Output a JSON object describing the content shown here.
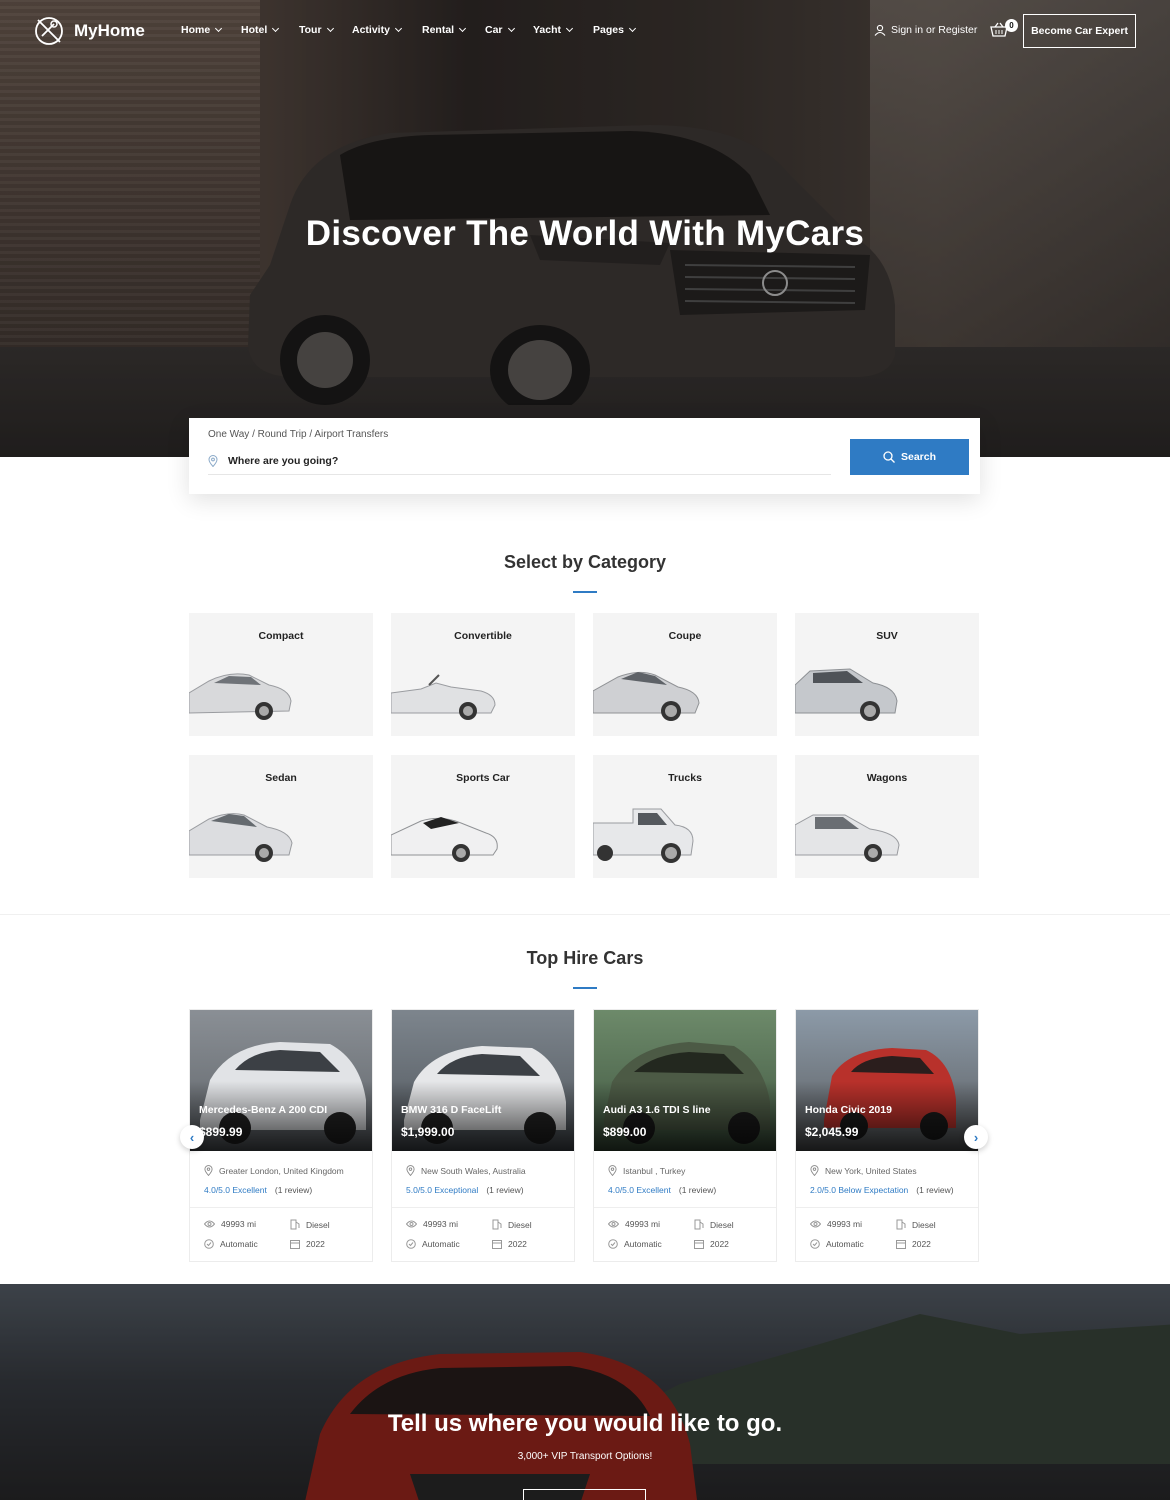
{
  "brand": {
    "name": "MyHome"
  },
  "nav": {
    "items": [
      "Home",
      "Hotel",
      "Tour",
      "Activity",
      "Rental",
      "Car",
      "Yacht",
      "Pages"
    ],
    "signin": "Sign in or Register",
    "cart_count": "0",
    "cta": "Become Car Expert"
  },
  "hero": {
    "title": "Discover The World With MyCars"
  },
  "search": {
    "trip_types": "One Way / Round Trip / Airport Transfers",
    "placeholder": "Where are you going?",
    "button": "Search"
  },
  "categories": {
    "title": "Select by Category",
    "items": [
      "Compact",
      "Convertible",
      "Coupe",
      "SUV",
      "Sedan",
      "Sports Car",
      "Trucks",
      "Wagons"
    ]
  },
  "top_cars": {
    "title": "Top Hire Cars",
    "cards": [
      {
        "name": "Mercedes-Benz A 200 CDI",
        "price": "$899.99",
        "location": "Greater London, United Kingdom",
        "score": "4.0/5.0 Excellent",
        "reviews": "(1 review)",
        "mileage": "49993 mi",
        "fuel": "Diesel",
        "transmission": "Automatic",
        "year": "2022",
        "color": "#c9ccd0"
      },
      {
        "name": "BMW 316 D FaceLift",
        "price": "$1,999.00",
        "location": "New South Wales, Australia",
        "score": "5.0/5.0 Exceptional",
        "reviews": "(1 review)",
        "mileage": "49993 mi",
        "fuel": "Diesel",
        "transmission": "Automatic",
        "year": "2022",
        "color": "#d6d8da"
      },
      {
        "name": "Audi A3 1.6 TDI S line",
        "price": "$899.00",
        "location": "Istanbul , Turkey",
        "score": "4.0/5.0 Excellent",
        "reviews": "(1 review)",
        "mileage": "49993 mi",
        "fuel": "Diesel",
        "transmission": "Automatic",
        "year": "2022",
        "color": "#4c5a45"
      },
      {
        "name": "Honda Civic 2019",
        "price": "$2,045.99",
        "location": "New York, United States",
        "score": "2.0/5.0 Below Expectation",
        "reviews": "(1 review)",
        "mileage": "49993 mi",
        "fuel": "Diesel",
        "transmission": "Automatic",
        "year": "2022",
        "color": "#b8312b"
      }
    ]
  },
  "cta": {
    "title": "Tell us where you would like to go.",
    "subtitle": "3,000+ VIP Transport Options!"
  },
  "colors": {
    "accent": "#2f7bc4"
  }
}
